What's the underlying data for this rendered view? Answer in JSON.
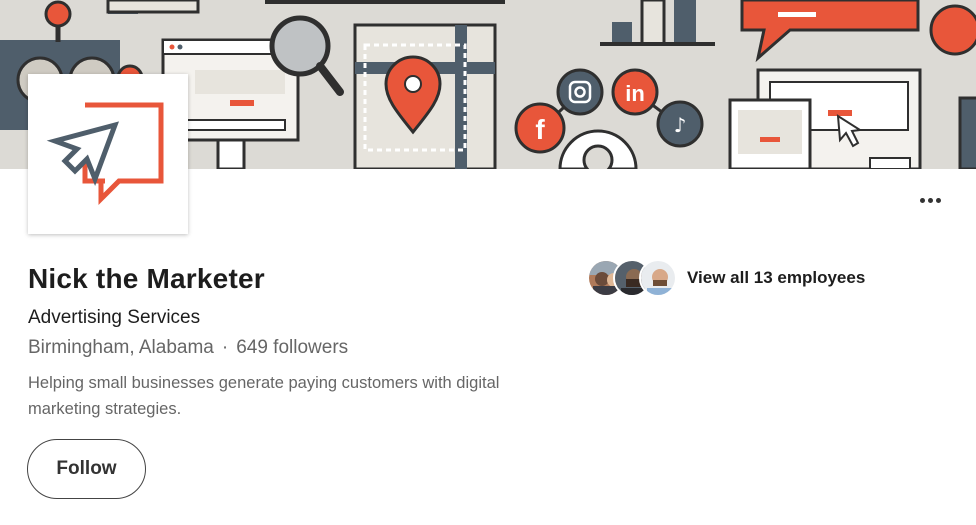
{
  "company": {
    "name": "Nick the Marketer",
    "industry": "Advertising Services",
    "location": "Birmingham, Alabama",
    "separator": "·",
    "followers": "649 followers",
    "tagline": "Helping small businesses generate paying customers with digital marketing strategies."
  },
  "actions": {
    "follow_label": "Follow",
    "more_icon": "more-horizontal-icon"
  },
  "employees": {
    "link_label": "View all 13 employees",
    "count": 13,
    "avatars": [
      "employee-avatar-1",
      "employee-avatar-2",
      "employee-avatar-3"
    ]
  },
  "colors": {
    "brand_orange": "#e8563a",
    "brand_slate": "#4f5e6b",
    "banner_bg": "#dcdad5",
    "text_primary": "#1d1d1d",
    "text_secondary": "#666666"
  }
}
